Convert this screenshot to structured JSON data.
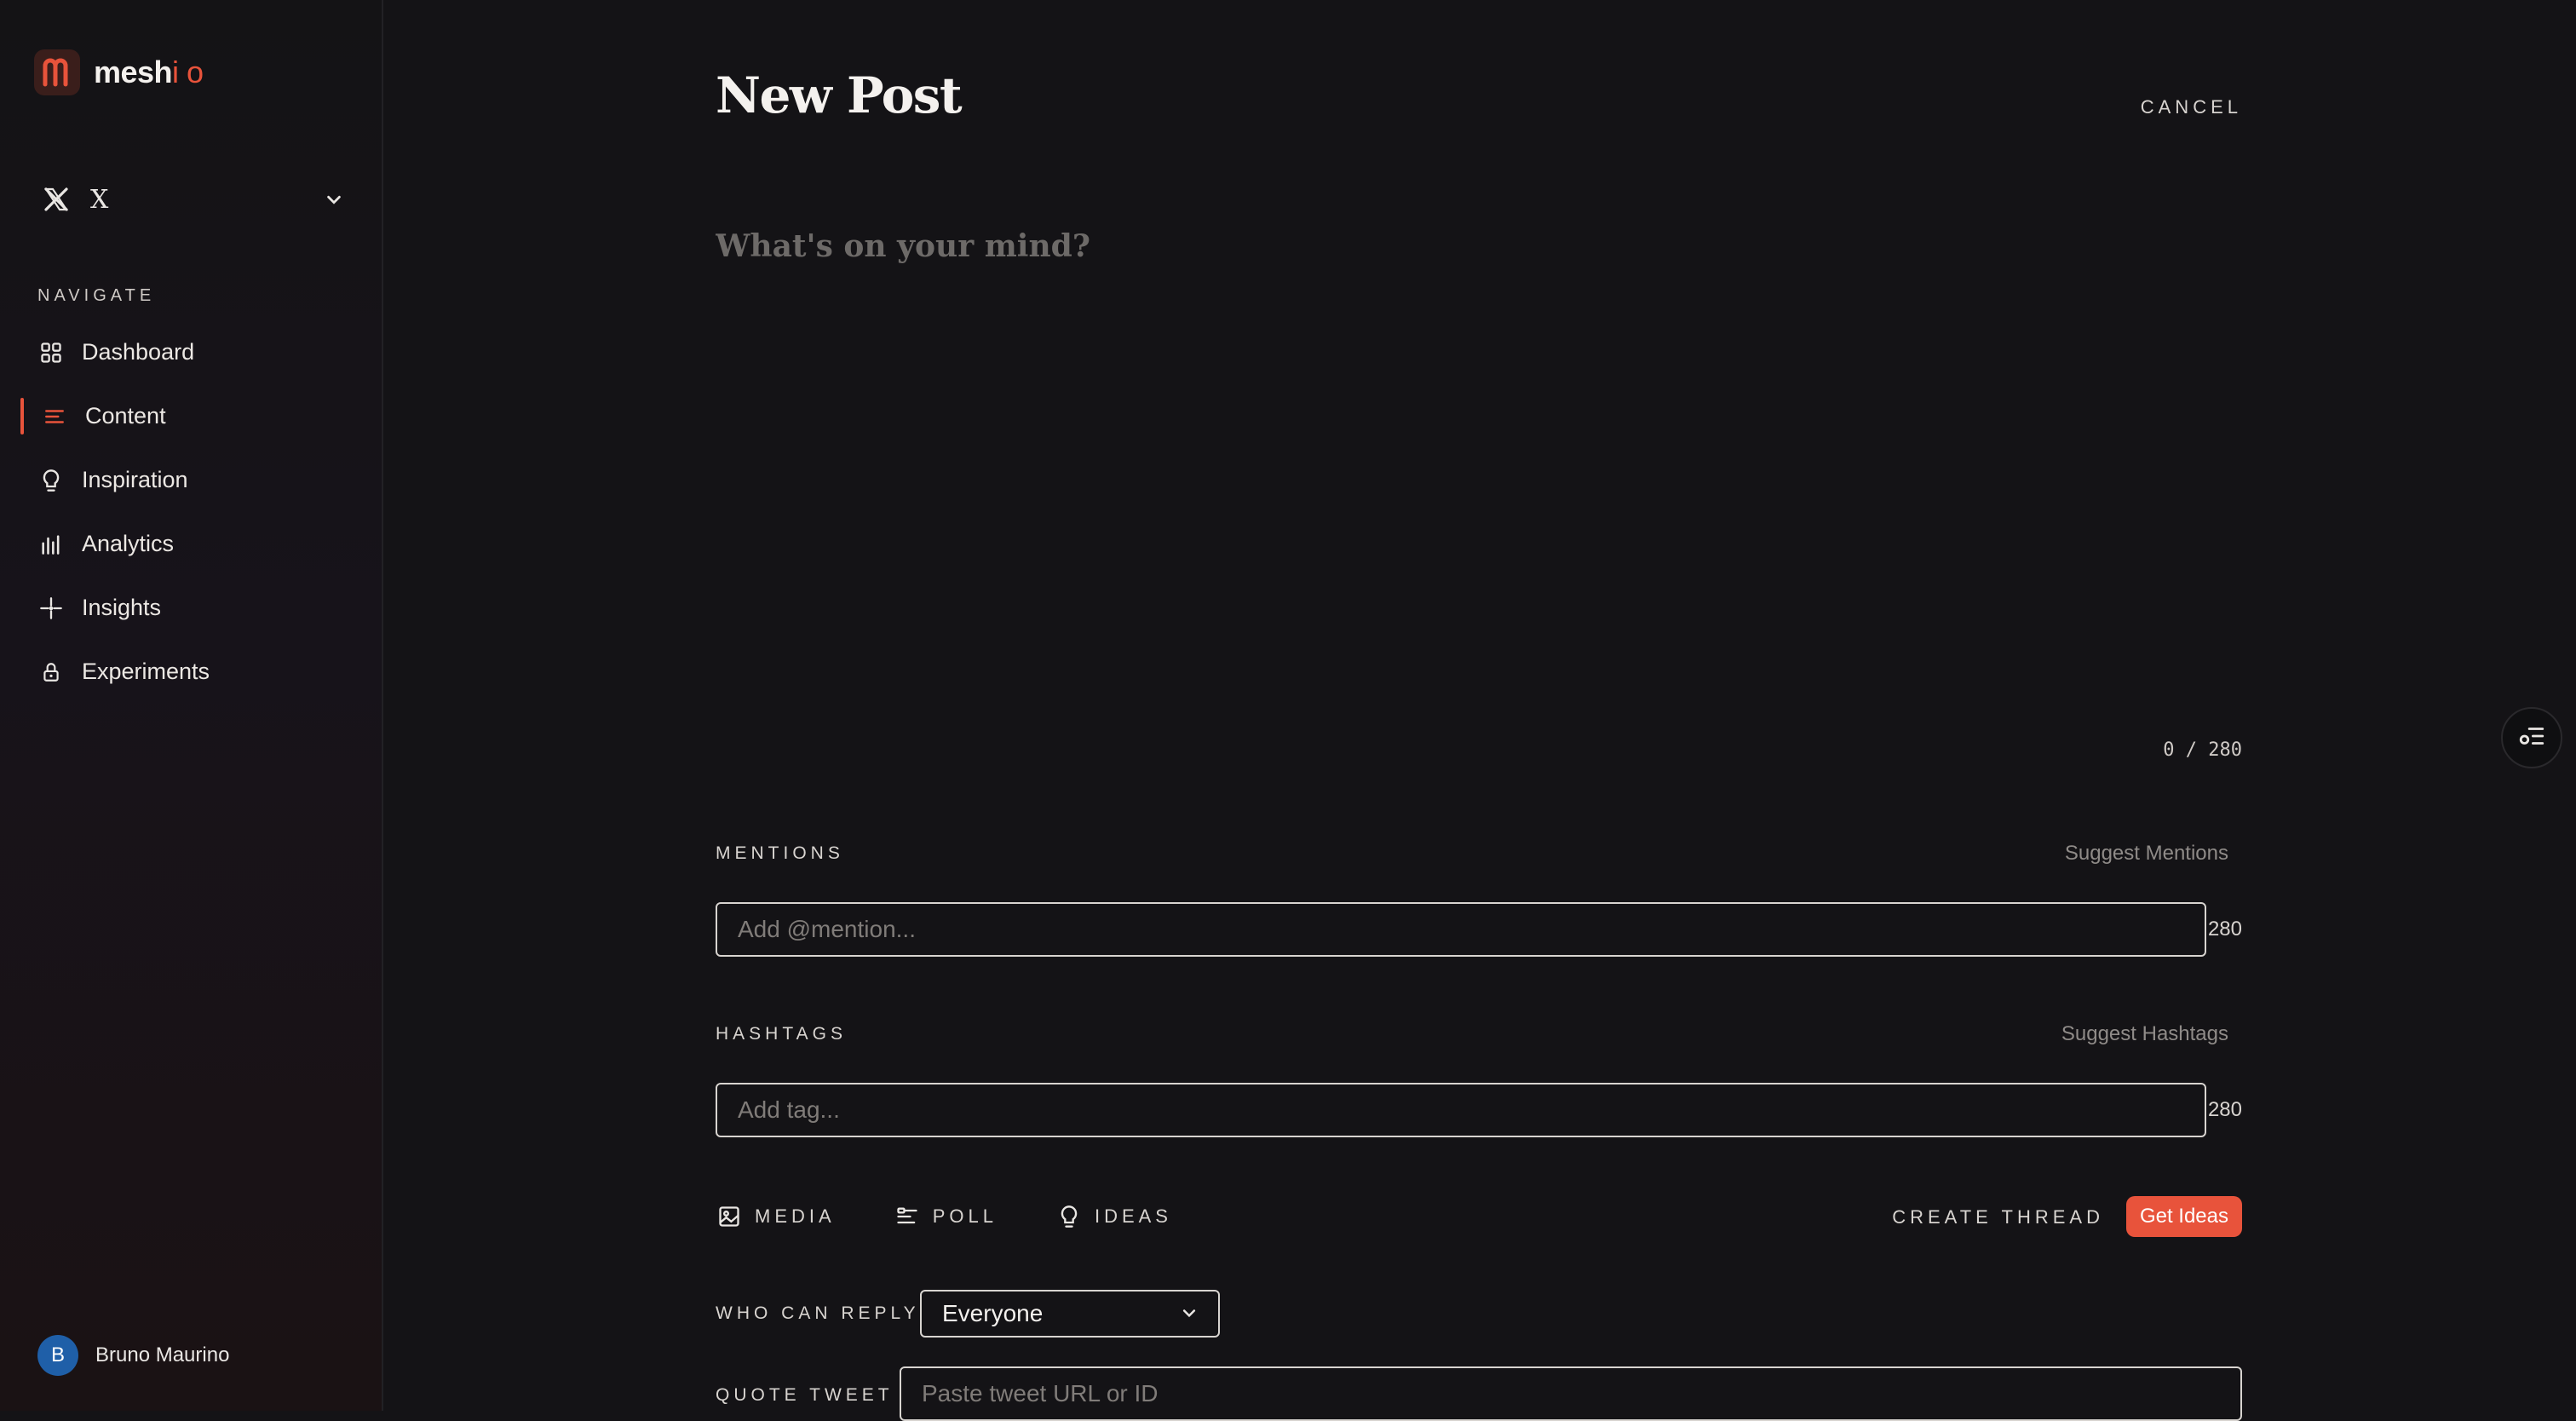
{
  "brand": {
    "name_main": "mesh",
    "name_accent": "i o",
    "accent_color": "#e8533b"
  },
  "account": {
    "platform": "X",
    "icon": "x-logo-icon"
  },
  "nav": {
    "heading": "NAVIGATE",
    "items": [
      {
        "label": "Dashboard",
        "icon": "grid-icon",
        "active": false
      },
      {
        "label": "Content",
        "icon": "lines-icon",
        "active": true
      },
      {
        "label": "Inspiration",
        "icon": "lightbulb-icon",
        "active": false
      },
      {
        "label": "Analytics",
        "icon": "bar-chart-icon",
        "active": false
      },
      {
        "label": "Insights",
        "icon": "sparkle-icon",
        "active": false
      },
      {
        "label": "Experiments",
        "icon": "lock-icon",
        "active": false
      }
    ]
  },
  "user": {
    "initial": "B",
    "name": "Bruno Maurino"
  },
  "page": {
    "title": "New Post",
    "cancel": "CANCEL"
  },
  "composer": {
    "placeholder": "What's on your mind?",
    "counter": "0 / 280"
  },
  "mentions": {
    "label": "MENTIONS",
    "suggest": "Suggest Mentions",
    "placeholder": "Add @mention...",
    "count": "280"
  },
  "hashtags": {
    "label": "HASHTAGS",
    "suggest": "Suggest Hashtags",
    "placeholder": "Add tag...",
    "count": "280"
  },
  "toolbar": {
    "media": "MEDIA",
    "poll": "POLL",
    "ideas": "IDEAS",
    "create_thread": "CREATE THREAD",
    "get_ideas": "Get Ideas"
  },
  "reply": {
    "label": "WHO CAN REPLY",
    "value": "Everyone"
  },
  "quote": {
    "label": "QUOTE TWEET",
    "placeholder": "Paste tweet URL or ID"
  }
}
